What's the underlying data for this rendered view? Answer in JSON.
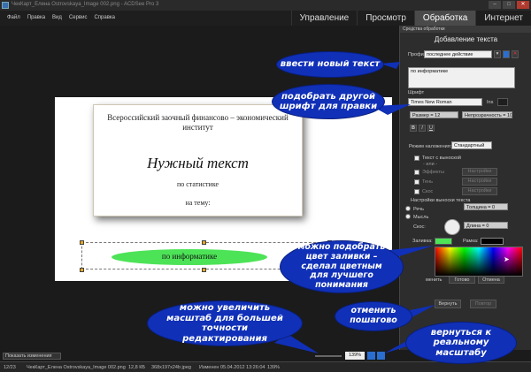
{
  "window": {
    "title": "ЧекКарт_Елена Ostrovskaya_Image 002.png - ACDSee Pro 3",
    "min": "–",
    "max": "□",
    "close": "✕"
  },
  "menu": [
    "Файл",
    "Правка",
    "Вид",
    "Сервис",
    "Справка"
  ],
  "tabs": [
    {
      "label": "Управление"
    },
    {
      "label": "Просмотр"
    },
    {
      "label": "Обработка"
    },
    {
      "label": "Интернет"
    }
  ],
  "document": {
    "line1": "Всероссийский  заочный  финансово – экономический",
    "line2": "институт",
    "big": "Нужный текст",
    "line3": "по статистике",
    "line4": "на тему:",
    "green_text": "по информатике"
  },
  "panel": {
    "header": "Средства обработки",
    "title": "Добавление текста",
    "profile_label": "Профили",
    "profile_value": "последнее действие",
    "text_value": "по информатике",
    "font_section": "Шрифт",
    "font_value": "Times New Roman",
    "ins_label": "Ins",
    "size_value": "Размер = 12",
    "opacity_value": "Непрозрачность = 100",
    "bold": "B",
    "italic": "I",
    "underline": "U",
    "blend_label": "Режим наложения:",
    "blend_value": "Стандартный",
    "callout_cb": "Текст с выноской",
    "or_label": "- или -",
    "effects_cb": "Эффекты",
    "shadow_cb": "Тень",
    "bevel_cb": "Скос",
    "settings": "Настройки",
    "callout_settings": "Настройки выноски текста",
    "thickness": "Толщина = 0",
    "speech": "Речь",
    "thought": "Мысль",
    "bevel_label": "Скос:",
    "length": "Длина = 0",
    "fill_label": "Заливка:",
    "frame_label": "Рамка:",
    "cancel_partial": "менить",
    "done": "Готово",
    "cancel": "Отмена",
    "undo": "Вернуть",
    "redo": "Повтор"
  },
  "callouts": {
    "c1": "ввести новый текст",
    "c2": "подобрать другой шрифт для правки",
    "c3": "можно подобрать цвет заливки – сделал цветным для лучшего понимания",
    "c4": "отменить пошагово",
    "c5": "можно увеличить масштаб для большей точности редактирования",
    "c6": "вернуться к реальному масштабу"
  },
  "zoombar": {
    "show_changes": "Показать изменения",
    "zoom": "139%"
  },
  "status": {
    "index": "12/23",
    "file": "ЧекКарт_Елена Ostrovskaya_Image 002.png",
    "size": "12,8 КБ",
    "dims": "368x197x24b jpeg",
    "modified": "Изменен 05.04.2012 13:26:04",
    "zoom": "139%"
  },
  "colors": {
    "callout_blue": "#1030b8",
    "fill_green": "#4de357",
    "active_tab": "#4a4a4a"
  }
}
